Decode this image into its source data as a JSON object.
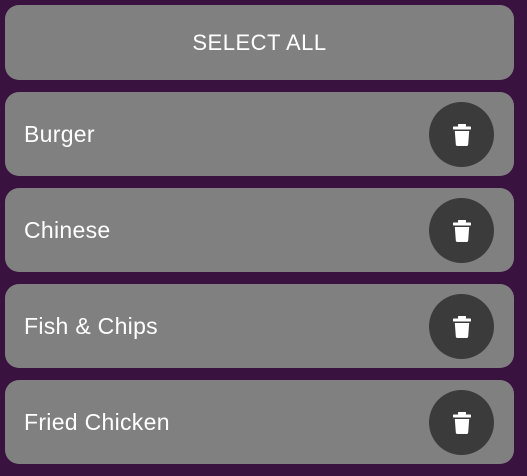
{
  "select_all": {
    "label": "SELECT ALL"
  },
  "items": [
    {
      "label": "Burger",
      "delete_icon": "trash-icon"
    },
    {
      "label": "Chinese",
      "delete_icon": "trash-icon"
    },
    {
      "label": "Fish & Chips",
      "delete_icon": "trash-icon"
    },
    {
      "label": "Fried Chicken",
      "delete_icon": "trash-icon"
    }
  ],
  "colors": {
    "background": "#3a1240",
    "card": "#808080",
    "delete_button": "#3b3b3b",
    "text": "#ffffff"
  }
}
